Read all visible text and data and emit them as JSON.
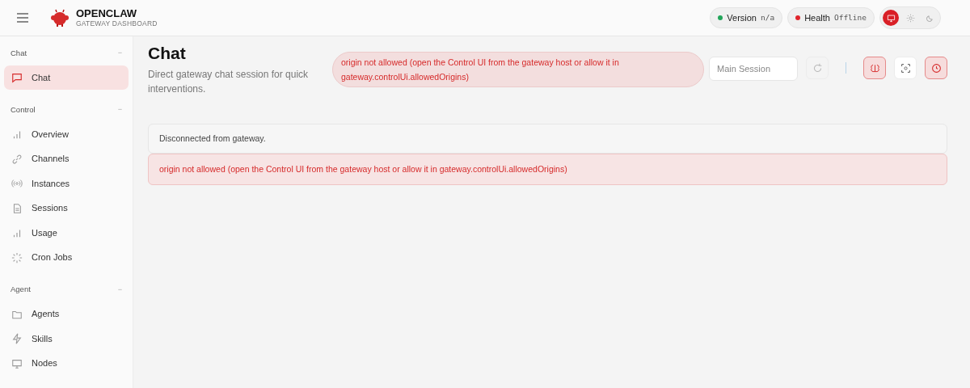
{
  "brand": {
    "title": "OPENCLAW",
    "subtitle": "GATEWAY DASHBOARD"
  },
  "status_pills": [
    {
      "label": "Version",
      "value": "n/a",
      "color": "#22a55a"
    },
    {
      "label": "Health",
      "value": "Offline",
      "color": "#e0242b"
    }
  ],
  "theme_toggle": [
    {
      "kind": "monitor",
      "selected": true
    },
    {
      "kind": "sun",
      "selected": false
    },
    {
      "kind": "moon",
      "selected": false
    }
  ],
  "sidebar": {
    "sections": [
      {
        "title": "Chat",
        "collapse": "−",
        "items": [
          {
            "label": "Chat",
            "kind": "chat",
            "selected": true
          }
        ]
      },
      {
        "title": "Control",
        "collapse": "−",
        "items": [
          {
            "label": "Overview",
            "kind": "bars",
            "selected": false
          },
          {
            "label": "Channels",
            "kind": "link",
            "selected": false
          },
          {
            "label": "Instances",
            "kind": "radio",
            "selected": false
          },
          {
            "label": "Sessions",
            "kind": "file",
            "selected": false
          },
          {
            "label": "Usage",
            "kind": "bars",
            "selected": false
          },
          {
            "label": "Cron Jobs",
            "kind": "loader",
            "selected": false
          }
        ]
      },
      {
        "title": "Agent",
        "collapse": "−",
        "items": [
          {
            "label": "Agents",
            "kind": "folder",
            "selected": false
          },
          {
            "label": "Skills",
            "kind": "bolt",
            "selected": false
          },
          {
            "label": "Nodes",
            "kind": "monitor",
            "selected": false
          }
        ]
      }
    ]
  },
  "page": {
    "title": "Chat",
    "subtitle": "Direct gateway chat session for quick interventions.",
    "error_banner": "origin not allowed (open the Control UI from the gateway host or allow it in gateway.controlUi.allowedOrigins)",
    "session_field": {
      "placeholder": "Main Session"
    },
    "toolbar": [
      {
        "kind": "refresh",
        "active": false,
        "disabled": true
      },
      {
        "kind": "brain",
        "active": true,
        "disabled": false
      },
      {
        "kind": "focus",
        "active": false,
        "disabled": false
      },
      {
        "kind": "clock",
        "active": true,
        "disabled": false
      }
    ]
  },
  "messages": [
    {
      "kind": "info",
      "text": "Disconnected from gateway."
    },
    {
      "kind": "error",
      "text": "origin not allowed (open the Control UI from the gateway host or allow it in gateway.controlUi.allowedOrigins)"
    }
  ]
}
